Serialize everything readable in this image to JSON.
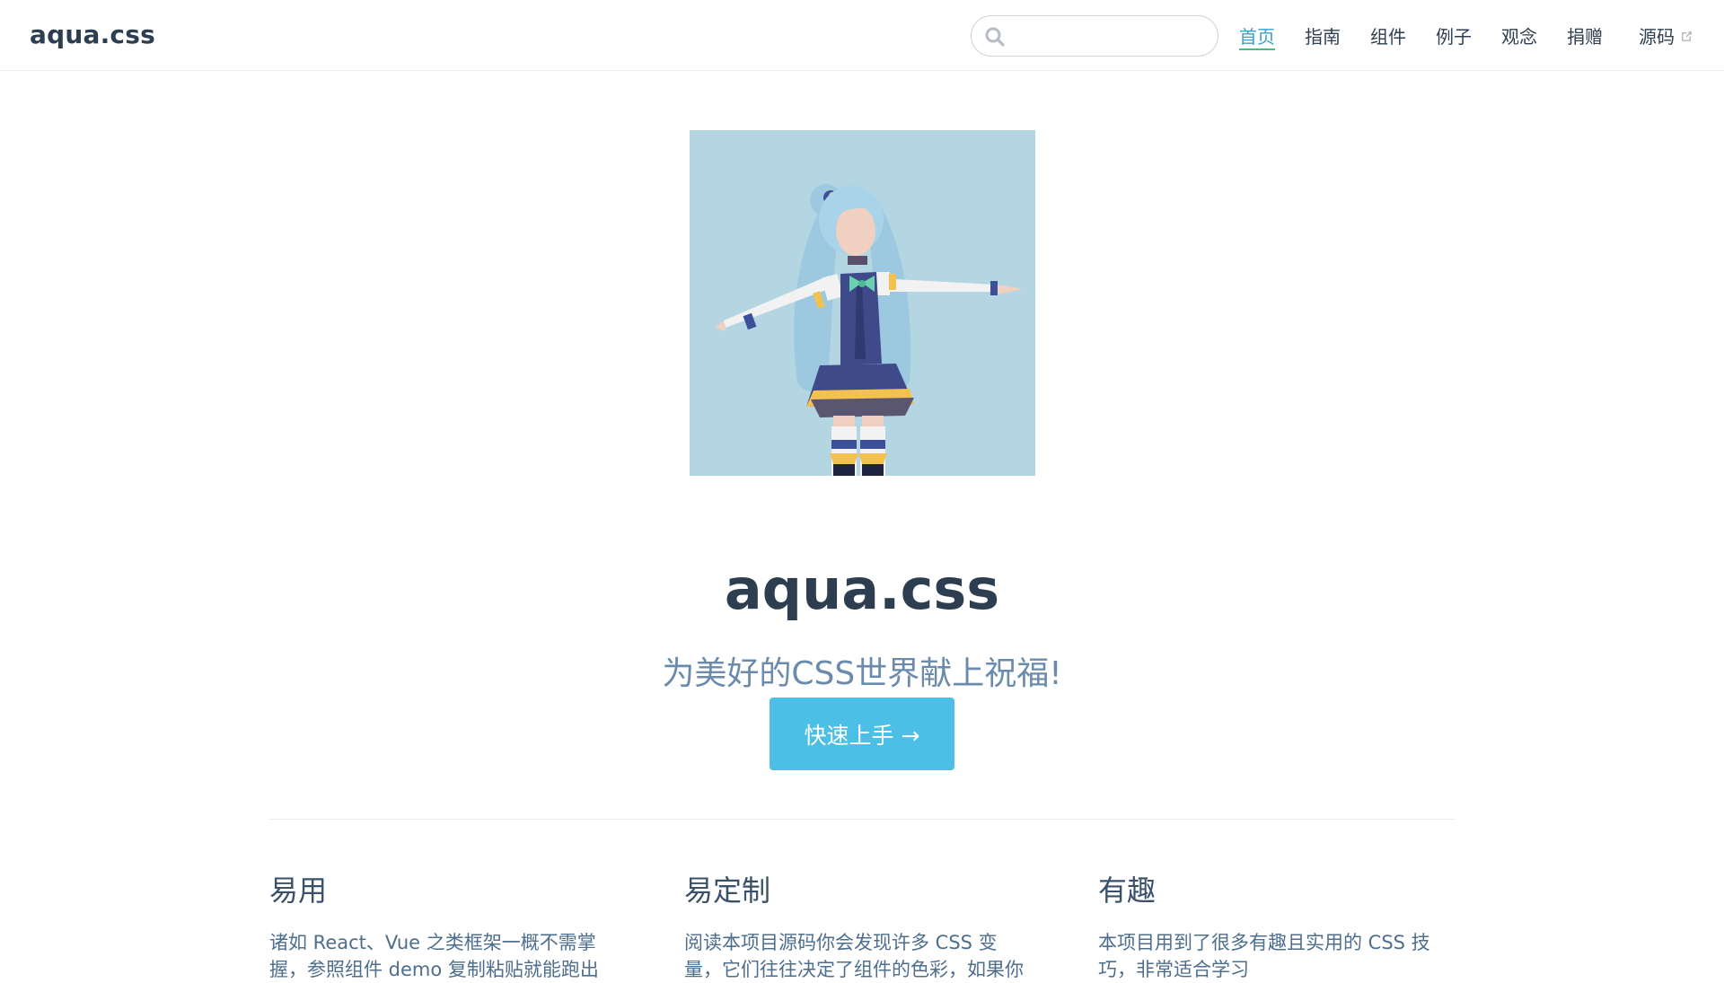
{
  "navbar": {
    "site_name": "aqua.css",
    "search": {
      "value": "",
      "placeholder": ""
    },
    "links": [
      {
        "label": "首页",
        "active": true
      },
      {
        "label": "指南",
        "active": false
      },
      {
        "label": "组件",
        "active": false
      },
      {
        "label": "例子",
        "active": false
      },
      {
        "label": "观念",
        "active": false
      },
      {
        "label": "捐赠",
        "active": false
      },
      {
        "label": "源码",
        "active": false,
        "external": true
      }
    ]
  },
  "hero": {
    "title": "aqua.css",
    "tagline": "为美好的CSS世界献上祝福!",
    "cta_label": "快速上手 →"
  },
  "features": [
    {
      "title": "易用",
      "text": "诸如 React、Vue 之类框架一概不需掌握，参照组件 demo 复制粘贴就能跑出"
    },
    {
      "title": "易定制",
      "text": "阅读本项目源码你会发现许多 CSS 变量，它们往往决定了组件的色彩，如果你"
    },
    {
      "title": "有趣",
      "text": "本项目用到了很多有趣且实用的 CSS 技巧，非常适合学习"
    }
  ],
  "colors": {
    "accent": "#4bbfe5",
    "active_link": "#3a9fd1",
    "active_underline": "#46bd87",
    "hero_bg": "#b3d6e2",
    "tagline": "#6a8bad",
    "text_dark": "#2c3e50"
  },
  "icons": {
    "search": "search-icon",
    "external": "external-link-icon",
    "hero": "aqua-illustration"
  }
}
